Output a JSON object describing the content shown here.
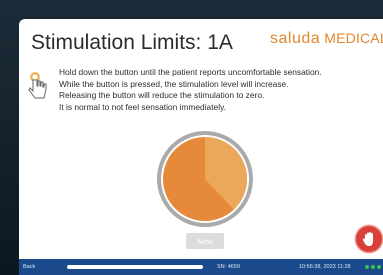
{
  "header": {
    "title": "Stimulation Limits: 1A",
    "logo_brand": "saluda",
    "logo_suffix": "MEDICAL"
  },
  "instructions": [
    "Hold down the button until the patient reports uncomfortable sensation.",
    "While the button is pressed, the stimulation level will increase.",
    "Releasing the button will reduce the stimulation to zero.",
    "It is normal to not feel sensation immediately."
  ],
  "gauge": {
    "level_fraction": 0.38,
    "fill_color": "#e7893a",
    "level_color": "#eba85b",
    "ring_color": "#aaaaaa"
  },
  "buttons": {
    "next_label": "Next"
  },
  "status_bar": {
    "back_label": "Back",
    "serial": "SN: 4659",
    "datetime": "10:56:38, 2023 11:28"
  },
  "icons": {
    "press": "hand-press-icon",
    "stop": "hand-stop-icon"
  }
}
